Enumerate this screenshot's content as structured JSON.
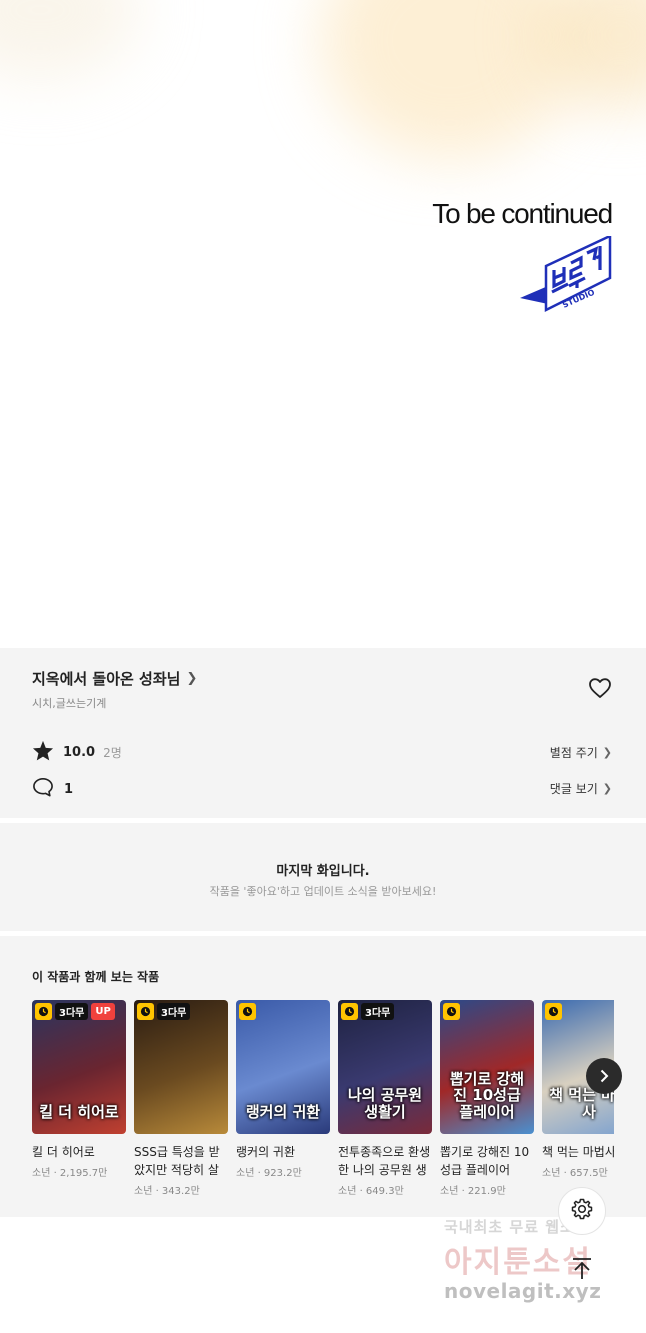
{
  "comic": {
    "end_text": "To be continued",
    "studio_logo": "블루픽 STUDIO"
  },
  "work": {
    "title": "지옥에서 돌아온 성좌님",
    "authors": "시치,글쓰는기계",
    "rating": "10.0",
    "rating_count": "2명",
    "comment_count": "1",
    "give_star_label": "별점 주기",
    "see_comments_label": "댓글 보기"
  },
  "last_episode": {
    "title": "마지막 화입니다.",
    "subtitle": "작품을 '좋아요'하고 업데이트 소식을 받아보세요!"
  },
  "recommendations": {
    "heading": "이 작품과 함께 보는 작품",
    "items": [
      {
        "name": "킬 더 히어로",
        "meta": "소년 · 2,195.7만",
        "free_badge": "3다무",
        "up_badge": "UP",
        "cover_text": "킬 더 히어로",
        "colors": [
          "#2a3560",
          "#6a2530",
          "#c04030"
        ]
      },
      {
        "name": "SSS급 특성을 받았지만 적당히 살겠습니다",
        "meta": "소년 · 343.2만",
        "free_badge": "3다무",
        "up_badge": "",
        "cover_text": "",
        "colors": [
          "#2a1c12",
          "#6a4a20",
          "#b88a3a"
        ]
      },
      {
        "name": "랭커의 귀환",
        "meta": "소년 · 923.2만",
        "free_badge": "",
        "up_badge": "",
        "cover_text": "랭커의 귀환",
        "colors": [
          "#3a5aa8",
          "#6a8ad0",
          "#2a3a7a"
        ]
      },
      {
        "name": "전투종족으로 환생한 나의 공무원 생활기",
        "meta": "소년 · 649.3만",
        "free_badge": "3다무",
        "up_badge": "",
        "cover_text": "나의 공무원 생활기",
        "colors": [
          "#1e2240",
          "#3a3a70",
          "#7a2a3a"
        ]
      },
      {
        "name": "뽑기로 강해진 10성급 플레이어",
        "meta": "소년 · 221.9만",
        "free_badge": "",
        "up_badge": "",
        "cover_text": "뽑기로 강해진 10성급 플레이어",
        "colors": [
          "#2a4a8a",
          "#a02828",
          "#4a90d0"
        ]
      },
      {
        "name": "책 먹는 마법사",
        "meta": "소년 · 657.5만",
        "free_badge": "",
        "up_badge": "",
        "cover_text": "책 먹는 마법사",
        "colors": [
          "#3a6ab0",
          "#d8d0c0",
          "#7aa0d0"
        ]
      }
    ]
  },
  "watermark": {
    "line1": "국내최초 무료 웹소설",
    "line2": "아지툰소설",
    "line3": "novelagit.xyz"
  },
  "colors": {
    "panel_bg": "#f4f4f4",
    "logo_blue": "#1f2fb8",
    "badge_yellow": "#ffc400",
    "badge_red": "#f0413d"
  }
}
